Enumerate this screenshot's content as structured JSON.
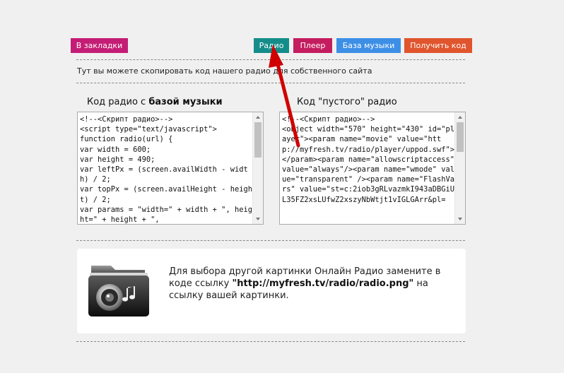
{
  "colors": {
    "bookmark": "#c41d75",
    "radio": "#148d8a",
    "player": "#c41d5f",
    "music_base": "#3d8fe6",
    "get_code": "#e0552d",
    "annotation_arrow": "#d00000"
  },
  "toolbar": {
    "bookmark_label": "В закладки",
    "radio_label": "Радио",
    "player_label": "Плеер",
    "music_base_label": "База музыки",
    "get_code_label": "Получить код"
  },
  "intro_text": "Тут вы можете скопировать код нашего радио для собственного сайта",
  "left_col": {
    "title_prefix": "Код радио с ",
    "title_bold": "базой музыки",
    "code": [
      "<!--<Скрипт радио>-->",
      "<script type=\"text/javascript\">",
      "function radio(url) {",
      "var width = 600;",
      "var height = 490;",
      "var leftPx = (screen.availWidth - width) / 2;",
      "var topPx = (screen.availHeight - height) / 2;",
      "var params = \"width=\" + width + \", height=\" + height + \","
    ]
  },
  "right_col": {
    "title": "Код \"пустого\" радио",
    "code": [
      "<!--<Скрипт радио>-->",
      "<object width=\"570\" height=\"430\" id=\"player\"><param name=\"movie\" value=\"http://myfresh.tv/radio/player/uppod.swf\"></param><param name=\"allowscriptaccess\" value=\"always\"/><param name=\"wmode\" value=\"transparent\" /><param name=\"FlashVars\" value=\"st=c:2iob3gRLvazmkI943aDBGiUL35FZ2xsLUfwZ2xszyNbWtjt1vIGLGArr&pl="
    ]
  },
  "info_panel": {
    "icon": "audio-folder-icon",
    "text_part1": "Для выбора другой картинки Онлайн Радио замените в коде ссылку ",
    "text_bold": "\"http://myfresh.tv/radio/radio.png\"",
    "text_part2": " на ссылку вашей картинки."
  }
}
